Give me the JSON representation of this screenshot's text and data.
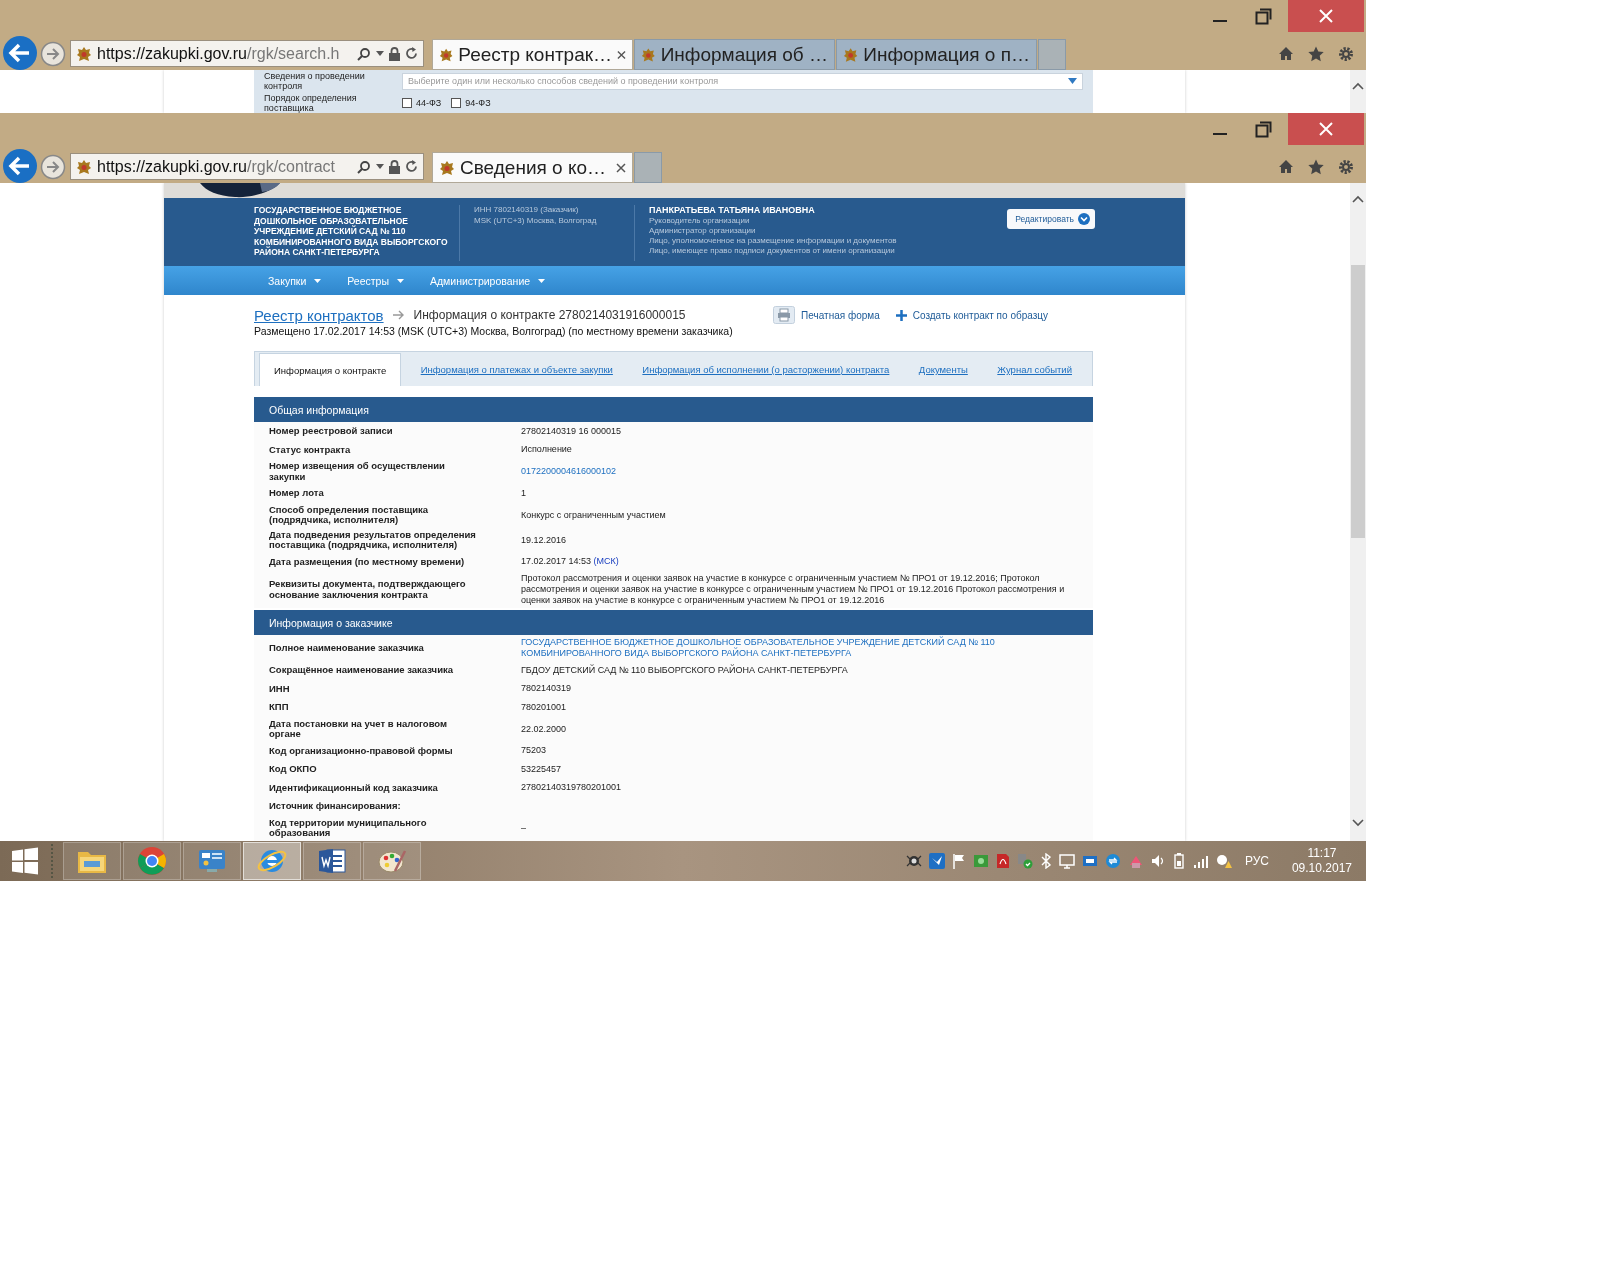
{
  "windows": [
    {
      "kind": "search_form",
      "address": {
        "host": "https://zakupki.gov.ru",
        "path": "/rgk/search.h"
      },
      "tabs": [
        {
          "label": "Реестр контрак…",
          "selected": true
        },
        {
          "label": "Информация об …",
          "selected": false
        },
        {
          "label": "Информация о п…",
          "selected": false
        }
      ],
      "form": {
        "select": {
          "label": "Сведения о проведении контроля",
          "placeholder": "Выберите один или несколько способов сведений о проведении контроля"
        },
        "checkbox_group": {
          "label": "Порядок определения поставщика",
          "options": [
            {
              "label": "44-ФЗ",
              "checked": false
            },
            {
              "label": "94-ФЗ",
              "checked": false
            }
          ]
        }
      }
    },
    {
      "kind": "contract_page",
      "address": {
        "host": "https://zakupki.gov.ru",
        "path": "/rgk/contract"
      },
      "tabs": [
        {
          "label": "Сведения о ко…",
          "selected": true
        }
      ],
      "page": {
        "org": {
          "name_lines": [
            "ГОСУДАРСТВЕННОЕ БЮДЖЕТНОЕ",
            "ДОШКОЛЬНОЕ ОБРАЗОВАТЕЛЬНОЕ",
            "УЧРЕЖДЕНИЕ ДЕТСКИЙ САД № 110",
            "КОМБИНИРОВАННОГО ВИДА ВЫБОРГСКОГО",
            "РАЙОНА САНКТ-ПЕТЕРБУРГА"
          ],
          "inn": "ИНН 7802140319 (Заказчик)",
          "timezone": "MSK (UTC+3) Москва, Волгоград"
        },
        "user": {
          "name": "ПАНКРАТЬЕВА ТАТЬЯНА ИВАНОВНА",
          "roles": [
            "Руководитель организации",
            "Администратор организации",
            "Лицо, уполномоченное на размещение информации и документов",
            "Лицо, имеющее право подписи документов от имени организации"
          ]
        },
        "edit_button": "Редактировать",
        "menu": [
          "Закупки",
          "Реестры",
          "Администрирование"
        ],
        "breadcrumb": {
          "link": "Реестр контрактов",
          "current": "Информация о контракте 2780214031916000015"
        },
        "actions": [
          {
            "kind": "print",
            "label": "Печатная форма"
          },
          {
            "kind": "create",
            "label": "Создать контракт по образцу"
          }
        ],
        "posted": "Размещено 17.02.2017 14:53 (MSK (UTC+3) Москва, Волгоград) (по местному времени заказчика)",
        "tabs": [
          {
            "label": "Информация о контракте",
            "selected": true
          },
          {
            "label": "Информация о платежах и объекте закупки",
            "selected": false
          },
          {
            "label": "Информация об исполнении (о расторжении) контракта",
            "selected": false
          },
          {
            "label": "Документы",
            "selected": false
          },
          {
            "label": "Журнал событий",
            "selected": false
          }
        ],
        "sections": [
          {
            "title": "Общая информация",
            "rows": [
              {
                "label": "Номер реестровой записи",
                "value": "27802140319 16 000015",
                "kind": "text"
              },
              {
                "label": "Статус контракта",
                "value": "Исполнение",
                "kind": "text"
              },
              {
                "label": "Номер извещения об осуществлении закупки",
                "value": "0172200004616000102",
                "kind": "link"
              },
              {
                "label": "Номер лота",
                "value": "1",
                "kind": "text"
              },
              {
                "label": "Способ определения поставщика (подрядчика, исполнителя)",
                "value": "Конкурс с ограниченным участием",
                "kind": "text"
              },
              {
                "label": "Дата подведения результатов определения поставщика (подрядчика, исполнителя)",
                "value": "19.12.2016",
                "kind": "text"
              },
              {
                "label": "Дата размещения (по местному времени)",
                "value": "17.02.2017 14:53",
                "zone": "(МСК)",
                "kind": "datetime"
              },
              {
                "label": "Реквизиты документа, подтверждающего основание заключения контракта",
                "value": "Протокол рассмотрения и оценки заявок на участие в конкурсе с ограниченным участием № ПРО1 от 19.12.2016; Протокол рассмотрения и оценки заявок на участие в конкурсе с ограниченным участием № ПРО1 от 19.12.2016 Протокол рассмотрения и оценки заявок на участие в конкурсе с ограниченным участием № ПРО1 от 19.12.2016",
                "kind": "text"
              }
            ]
          },
          {
            "title": "Информация о заказчике",
            "rows": [
              {
                "label": "Полное наименование заказчика",
                "value": "ГОСУДАРСТВЕННОЕ БЮДЖЕТНОЕ ДОШКОЛЬНОЕ ОБРАЗОВАТЕЛЬНОЕ УЧРЕЖДЕНИЕ ДЕТСКИЙ САД № 110 КОМБИНИРОВАННОГО ВИДА ВЫБОРГСКОГО РАЙОНА САНКТ-ПЕТЕРБУРГА",
                "kind": "link"
              },
              {
                "label": "Сокращённое наименование заказчика",
                "value": "ГБДОУ ДЕТСКИЙ САД № 110 ВЫБОРГСКОГО РАЙОНА САНКТ-ПЕТЕРБУРГА",
                "kind": "text"
              },
              {
                "label": "ИНН",
                "value": "7802140319",
                "kind": "text"
              },
              {
                "label": "КПП",
                "value": "780201001",
                "kind": "text"
              },
              {
                "label": "Дата постановки на учет в налоговом органе",
                "value": "22.02.2000",
                "kind": "text"
              },
              {
                "label": "Код организационно-правовой формы",
                "value": "75203",
                "kind": "text"
              },
              {
                "label": "Код ОКПО",
                "value": "53225457",
                "kind": "text"
              },
              {
                "label": "Идентификационный код заказчика",
                "value": "27802140319780201001",
                "kind": "text"
              },
              {
                "label": "Источник финансирования:",
                "kind": "text"
              },
              {
                "label": "Код территории муниципального образования",
                "value": "–",
                "kind": "text"
              }
            ]
          }
        ]
      }
    }
  ],
  "taskbar": {
    "apps": [
      {
        "kind": "explorer",
        "active": false
      },
      {
        "kind": "chrome",
        "active": false
      },
      {
        "kind": "panel",
        "active": false
      },
      {
        "kind": "ie",
        "active": true
      },
      {
        "kind": "word",
        "active": false
      },
      {
        "kind": "paint",
        "active": false
      }
    ],
    "language": "РУС",
    "time": "11:17",
    "date": "09.10.2017"
  }
}
